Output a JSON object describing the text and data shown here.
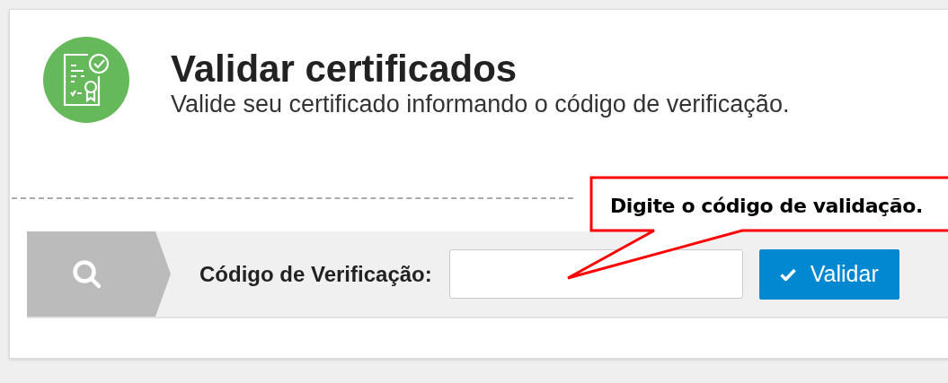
{
  "header": {
    "title": "Validar certificados",
    "subtitle": "Valide seu certificado informando o código de verificação."
  },
  "form": {
    "label": "Código de Verificação:",
    "button": "Validar"
  },
  "callout": {
    "text": "Digite o código de validação."
  }
}
